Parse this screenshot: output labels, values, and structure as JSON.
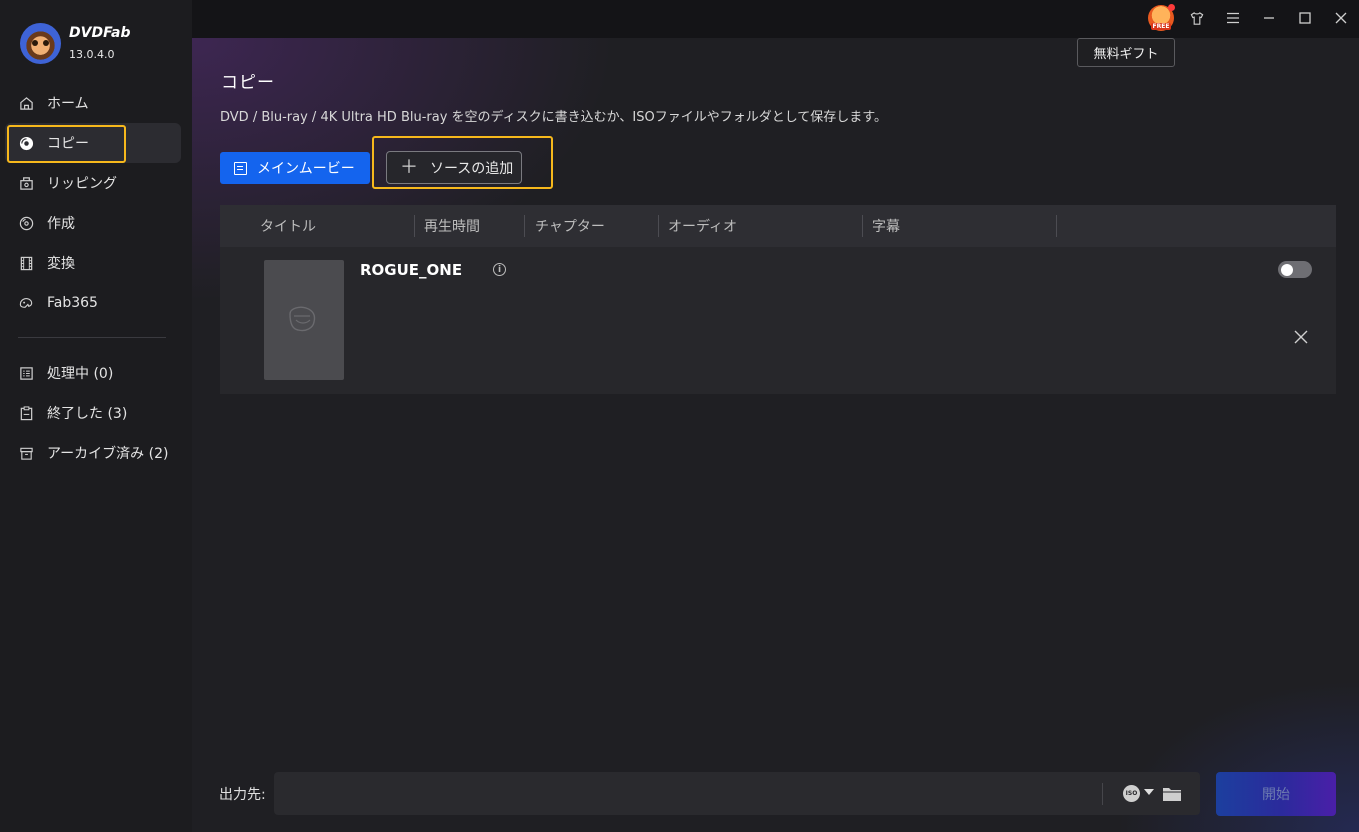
{
  "brand": {
    "name": "DVDFab",
    "version": "13.0.4.0"
  },
  "sidebar": {
    "items": [
      {
        "label": "ホーム",
        "icon": "home-icon"
      },
      {
        "label": "コピー",
        "icon": "disc-copy-icon"
      },
      {
        "label": "リッピング",
        "icon": "rip-icon"
      },
      {
        "label": "作成",
        "icon": "create-disc-icon"
      },
      {
        "label": "変換",
        "icon": "film-convert-icon"
      },
      {
        "label": "Fab365",
        "icon": "fab365-icon"
      }
    ],
    "tasks": [
      {
        "label": "処理中 (0)",
        "icon": "processing-list-icon"
      },
      {
        "label": "終了した (3)",
        "icon": "finished-clipboard-icon"
      },
      {
        "label": "アーカイブ済み (2)",
        "icon": "archive-box-icon"
      }
    ]
  },
  "titlebar": {
    "free_label": "FREE",
    "gift_tooltip": "無料ギフト"
  },
  "page": {
    "title": "コピー",
    "description": "DVD / Blu-ray / 4K Ultra HD Blu-ray を空のディスクに書き込むか、ISOファイルやフォルダとして保存します。",
    "main_button": "メインムービー",
    "add_source_button": "ソースの追加"
  },
  "table": {
    "columns": [
      "タイトル",
      "再生時間",
      "チャプター",
      "オーディオ",
      "字幕"
    ],
    "rows": [
      {
        "title": "ROGUE_ONE",
        "enabled": false
      }
    ]
  },
  "footer": {
    "output_label": "出力先:",
    "output_value": "",
    "iso_label": "ISO",
    "start_button": "開始"
  },
  "colors": {
    "accent": "#1464ee",
    "highlight": "#f6b81c",
    "sidebar_bg": "#1c1c1f",
    "main_bg": "#1f1f23"
  }
}
